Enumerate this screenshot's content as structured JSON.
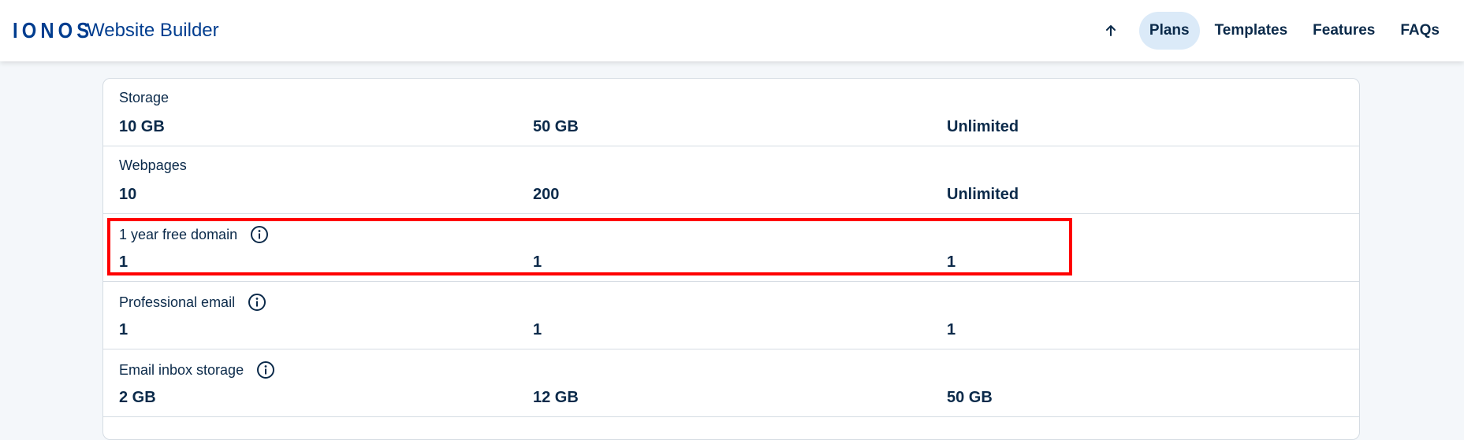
{
  "header": {
    "logo_text": "IONOS",
    "product_name": "Website Builder",
    "nav": {
      "back_to_top_icon": "arrow-up-icon",
      "items": [
        {
          "label": "Plans",
          "active": true
        },
        {
          "label": "Templates",
          "active": false
        },
        {
          "label": "Features",
          "active": false
        },
        {
          "label": "FAQs",
          "active": false
        }
      ]
    }
  },
  "table": {
    "rows": [
      {
        "label": "Storage",
        "has_info": false,
        "values": [
          "10 GB",
          "50 GB",
          "Unlimited"
        ]
      },
      {
        "label": "Webpages",
        "has_info": false,
        "values": [
          "10",
          "200",
          "Unlimited"
        ]
      },
      {
        "label": "1 year free domain",
        "has_info": true,
        "values": [
          "1",
          "1",
          "1"
        ]
      },
      {
        "label": "Professional email",
        "has_info": true,
        "values": [
          "1",
          "1",
          "1"
        ]
      },
      {
        "label": "Email inbox storage",
        "has_info": true,
        "values": [
          "2 GB",
          "12 GB",
          "50 GB"
        ]
      }
    ]
  },
  "colors": {
    "brand": "#003d8f",
    "text": "#0b2a4a",
    "active_nav_bg": "#dbeaf8",
    "highlight": "#ff0000",
    "page_bg": "#f4f7fa"
  }
}
